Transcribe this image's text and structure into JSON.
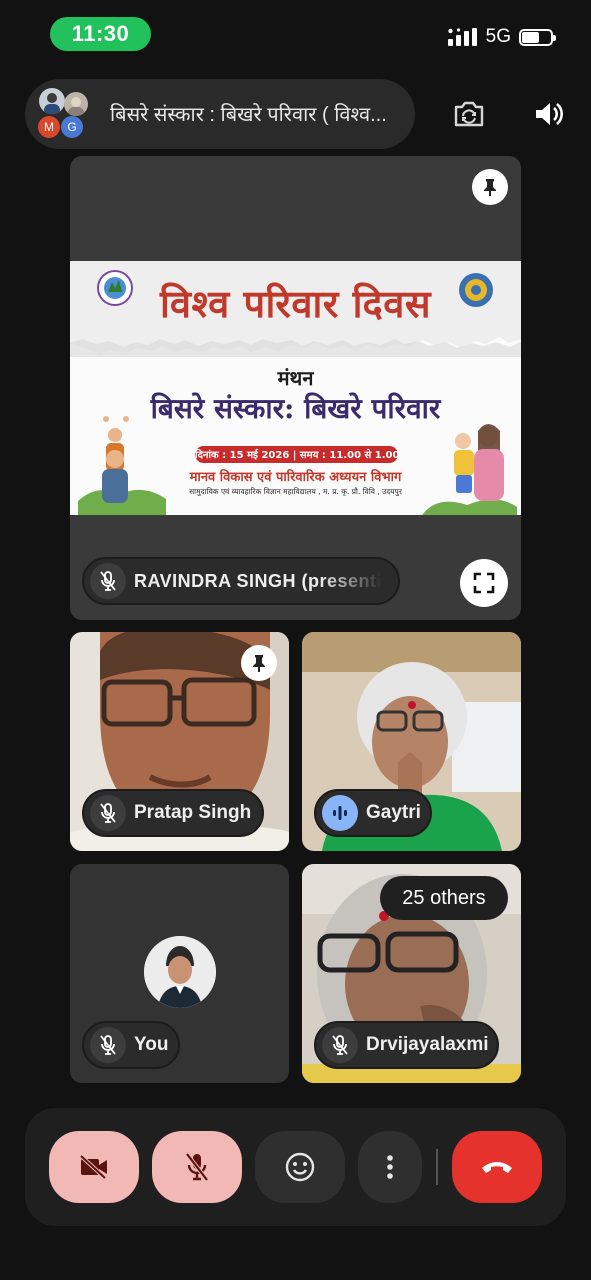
{
  "status_bar": {
    "time": "11:30",
    "network": "5G",
    "battery_level": 0.55
  },
  "meeting": {
    "title": "बिसरे संस्कार : बिखरे परिवार ( विश्व...",
    "avatar_initials": [
      "M",
      "G"
    ],
    "avatar_colors": [
      "#d9482b",
      "#4a7ad6"
    ]
  },
  "presentation": {
    "slide": {
      "heading": "विश्व परिवार दिवस",
      "subheading": "मंथन",
      "theme": "बिसरे संस्कार: बिखरे परिवार",
      "date_line": "दिनांक : 15 मई 2026 | समय : 11.00 से 1.00",
      "department": "मानव विकास एवं पारिवारिक अध्ययन विभाग",
      "college": "सामुदायिक एवं व्यावहारिक विज्ञान महाविद्यालय , म. प्र. कृ. प्रौ. विवि , उदयपुर"
    },
    "presenter_label": "RAVINDRA SINGH (presenti"
  },
  "participants": [
    {
      "name": "Pratap Singh",
      "muted": true,
      "pinned": true
    },
    {
      "name": "Gaytri",
      "muted": false,
      "speaking": true
    },
    {
      "name": "You",
      "muted": true
    },
    {
      "name": "Drvijayalaxmi",
      "muted": true
    }
  ],
  "others_badge": "25 others",
  "controls": [
    "camera-off",
    "mic-off",
    "reactions",
    "more-options",
    "end-call"
  ],
  "colors": {
    "accent_green": "#21c15c",
    "control_pink": "#f2b8b5",
    "end_call_red": "#e5322d",
    "speaking_blue": "#8ab4f8"
  }
}
